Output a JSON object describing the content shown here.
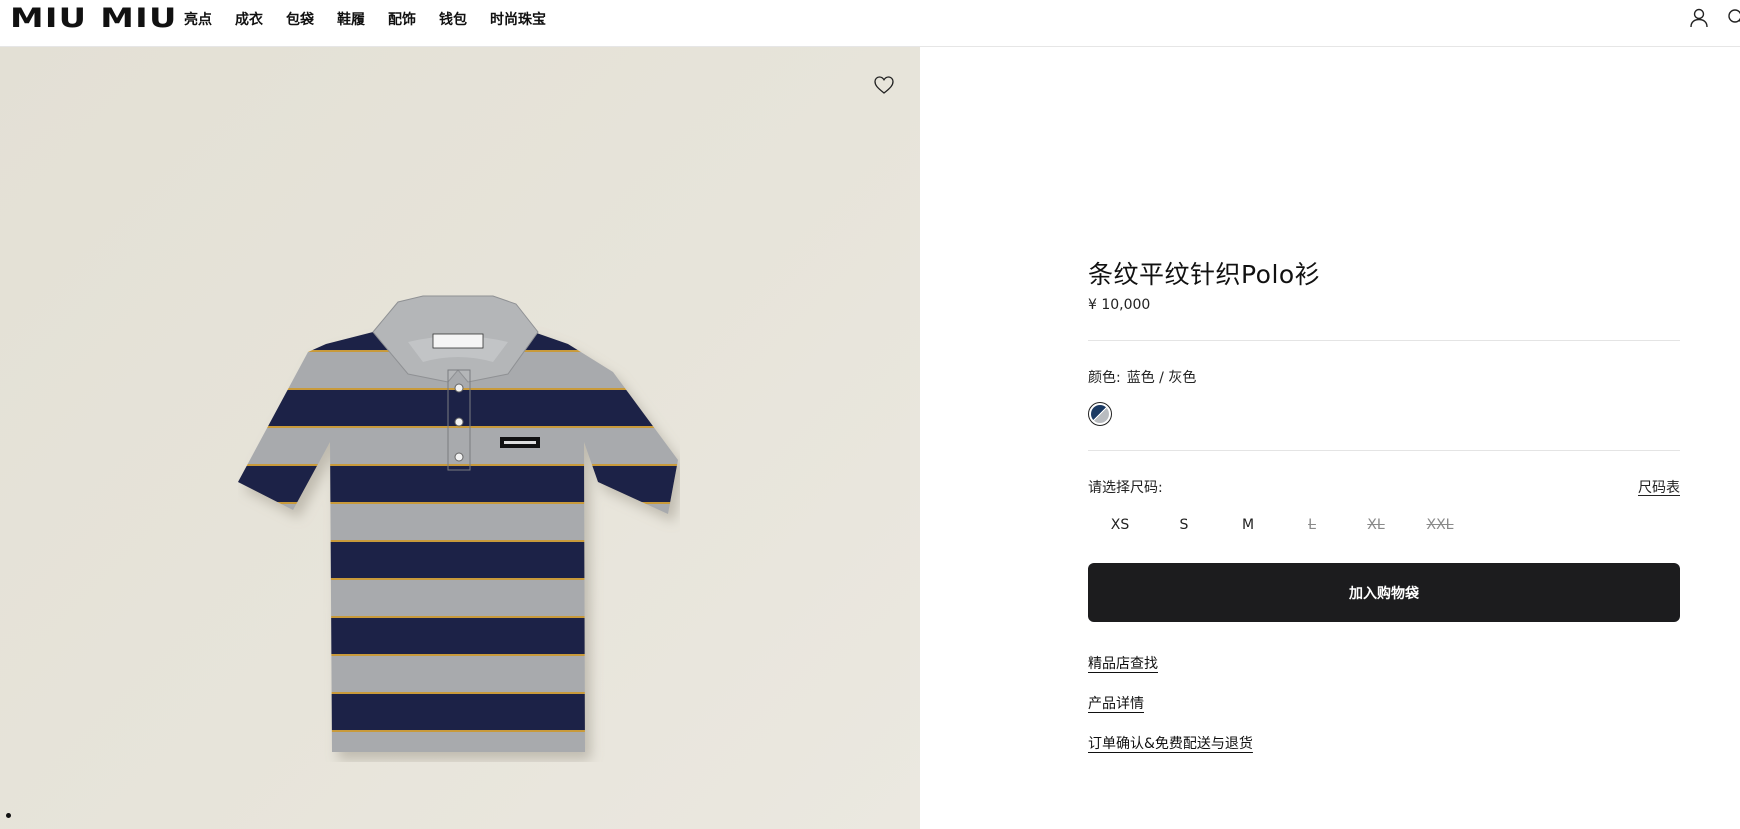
{
  "header": {
    "logo": "MIU MIU",
    "nav": [
      "亮点",
      "成衣",
      "包袋",
      "鞋履",
      "配饰",
      "钱包",
      "时尚珠宝"
    ],
    "icons": [
      "user-icon",
      "search-icon"
    ]
  },
  "product": {
    "title": "条纹平纹针织Polo衫",
    "price": "¥ 10,000",
    "color_label": "颜色:",
    "color_value": "蓝色 / 灰色",
    "swatch_colors": [
      "#1b3a63",
      "#b9bcc0"
    ],
    "size_label": "请选择尺码:",
    "size_chart": "尺码表",
    "sizes": [
      {
        "label": "XS",
        "available": true
      },
      {
        "label": "S",
        "available": true
      },
      {
        "label": "M",
        "available": true
      },
      {
        "label": "L",
        "available": false
      },
      {
        "label": "XL",
        "available": false
      },
      {
        "label": "XXL",
        "available": false
      }
    ],
    "add_to_bag": "加入购物袋",
    "links": [
      "精品店查找",
      "产品详情",
      "订单确认&免费配送与退货"
    ]
  },
  "colors": {
    "button_bg": "#1c1c1e",
    "image_bg": "#e5e2d8",
    "shirt_navy": "#1e2447",
    "shirt_grey": "#a9abad"
  }
}
